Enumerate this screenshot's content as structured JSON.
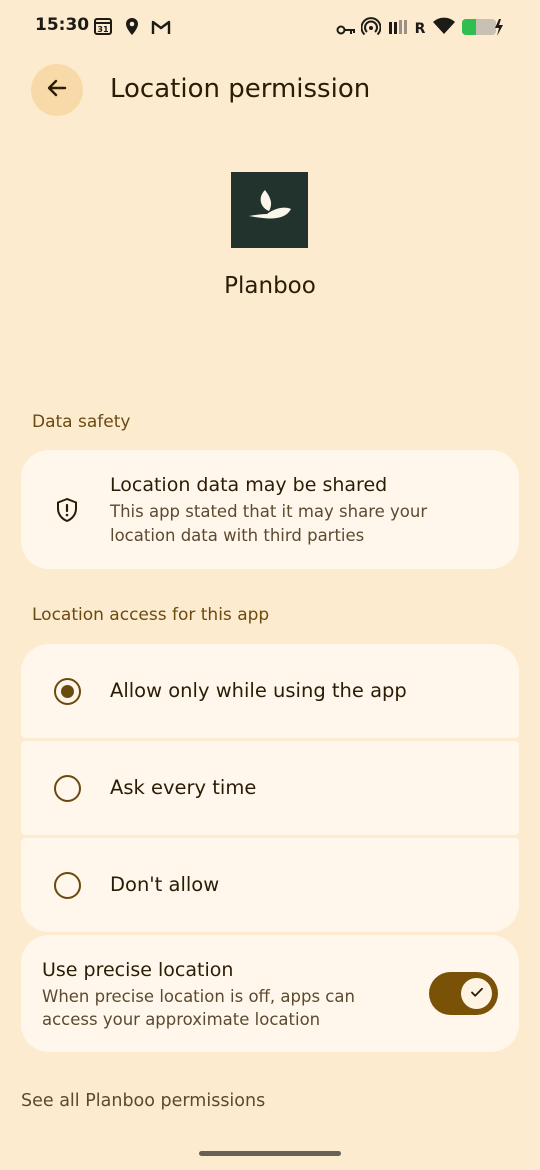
{
  "status_bar": {
    "time": "15:30",
    "calendar_day": "31",
    "network_label": "R",
    "icons": [
      "calendar-icon",
      "location-pin-icon",
      "gmail-icon",
      "vpn-key-icon",
      "hotspot-icon",
      "signal-icon",
      "wifi-icon",
      "battery-charging-icon"
    ]
  },
  "header": {
    "title": "Location permission",
    "back_icon": "arrow-back-icon"
  },
  "app": {
    "name": "Planboo",
    "icon": "planboo-leaf-logo"
  },
  "data_safety": {
    "section_label": "Data safety",
    "title": "Location data may be shared",
    "description_line1": "This app stated that it may share your",
    "description_line2": "location data with third parties",
    "icon": "shield-alert-icon"
  },
  "location_access": {
    "section_label": "Location access for this app",
    "options": [
      {
        "label": "Allow only while using the app",
        "selected": true
      },
      {
        "label": "Ask every time",
        "selected": false
      },
      {
        "label": "Don't allow",
        "selected": false
      }
    ]
  },
  "precise_location": {
    "title": "Use precise location",
    "description_line1": "When precise location is off, apps can",
    "description_line2": "access your approximate location",
    "enabled": true
  },
  "footer": {
    "link": "See all Planboo permissions"
  },
  "colors": {
    "background": "#fdebd0",
    "card": "#fff7ec",
    "accent": "#7a5207",
    "back_button": "#f8d9a8"
  }
}
